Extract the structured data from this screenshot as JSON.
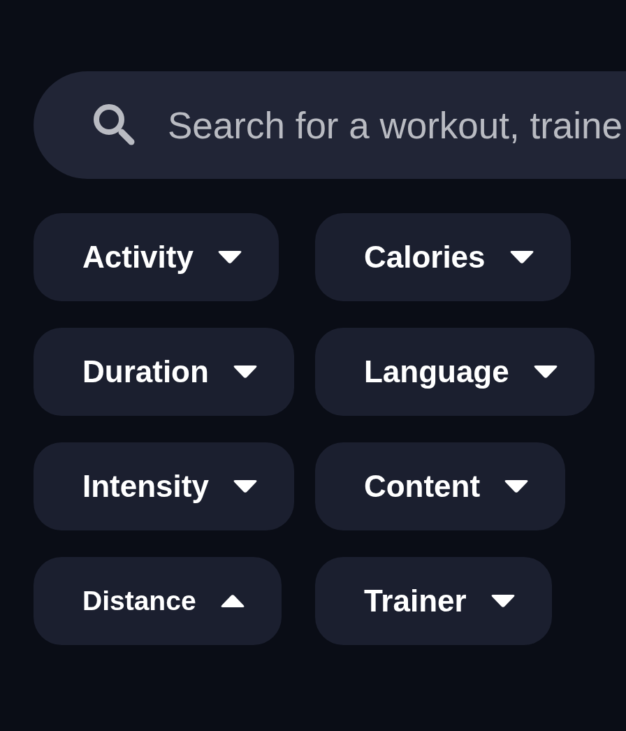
{
  "search": {
    "placeholder": "Search for a workout, traine"
  },
  "filters": [
    {
      "label": "Activity",
      "expanded": false
    },
    {
      "label": "Calories",
      "expanded": false
    },
    {
      "label": "Duration",
      "expanded": false
    },
    {
      "label": "Language",
      "expanded": false
    },
    {
      "label": "Intensity",
      "expanded": false
    },
    {
      "label": "Content",
      "expanded": false
    },
    {
      "label": "Distance",
      "expanded": true
    },
    {
      "label": "Trainer",
      "expanded": false
    }
  ]
}
